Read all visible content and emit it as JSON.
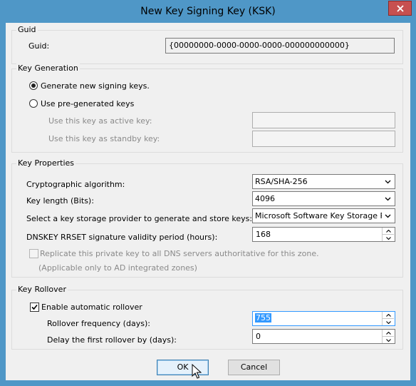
{
  "window": {
    "title": "New Key Signing Key (KSK)"
  },
  "guid_group": {
    "legend": "Guid",
    "label": "Guid:",
    "value": "{00000000-0000-0000-0000-000000000000}"
  },
  "key_generation": {
    "legend": "Key Generation",
    "radio_new": "Generate new signing keys.",
    "radio_pre": "Use pre-generated keys",
    "active_label": "Use this key as active key:",
    "standby_label": "Use this key as standby key:",
    "active_value": "",
    "standby_value": ""
  },
  "key_properties": {
    "legend": "Key Properties",
    "algo_label": "Cryptographic algorithm:",
    "algo_value": "RSA/SHA-256",
    "length_label": "Key length (Bits):",
    "length_value": "4096",
    "ksp_label": "Select a key storage provider to generate and store keys:",
    "ksp_value": "Microsoft Software Key Storage Provider",
    "validity_label": "DNSKEY RRSET signature validity period (hours):",
    "validity_value": "168",
    "replicate_label": "Replicate this private key to all DNS servers authoritative for this zone.",
    "replicate_note": "(Applicable only to AD integrated zones)"
  },
  "key_rollover": {
    "legend": "Key Rollover",
    "auto_label": "Enable automatic rollover",
    "freq_label": "Rollover frequency (days):",
    "freq_value": "755",
    "delay_label": "Delay the first rollover by (days):",
    "delay_value": "0"
  },
  "buttons": {
    "ok": "OK",
    "cancel": "Cancel"
  },
  "colors": {
    "titlebar": "#4f97c7",
    "close": "#c75050",
    "dialog": "#f0f0f0",
    "selection": "#3399ff"
  }
}
